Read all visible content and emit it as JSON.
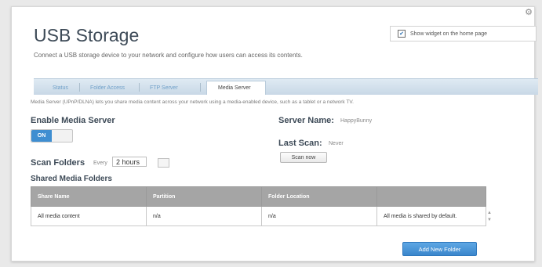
{
  "header": {
    "title": "USB Storage",
    "subtitle": "Connect a USB storage device to your network and configure how users can access its contents.",
    "show_widget_label": "Show widget on the home page",
    "show_widget_checked": true
  },
  "tabs": [
    {
      "label": "Status"
    },
    {
      "label": "Folder Access"
    },
    {
      "label": "FTP Server"
    },
    {
      "label": "Media Server"
    }
  ],
  "media_server": {
    "description": "Media Server (UPnP/DLNA) lets you share media content across your network using a media-enabled device, such as a tablet or a network TV.",
    "enable_label": "Enable Media Server",
    "toggle_state": "ON",
    "server_name_label": "Server Name:",
    "server_name_value": "HappyBunny",
    "last_scan_label": "Last Scan:",
    "last_scan_value": "Never",
    "scan_now_label": "Scan now",
    "scan_folders_label": "Scan Folders",
    "scan_every_label": "Every",
    "scan_interval": "2 hours"
  },
  "shared": {
    "title": "Shared Media Folders",
    "columns": [
      "Share Name",
      "Partition",
      "Folder Location",
      ""
    ],
    "rows": [
      [
        "All media content",
        "n/a",
        "n/a",
        "All media is shared by default."
      ]
    ],
    "add_label": "Add New Folder"
  },
  "icons": {
    "settings": "gear-icon",
    "checkbox": "checkbox-checked-icon",
    "dropdown": "dropdown-icon",
    "scroll": "scroll-arrows-icon"
  },
  "colors": {
    "accent": "#3f8ed1",
    "tab_bar": "#c8d8e6",
    "table_header": "#a5a5a5"
  }
}
